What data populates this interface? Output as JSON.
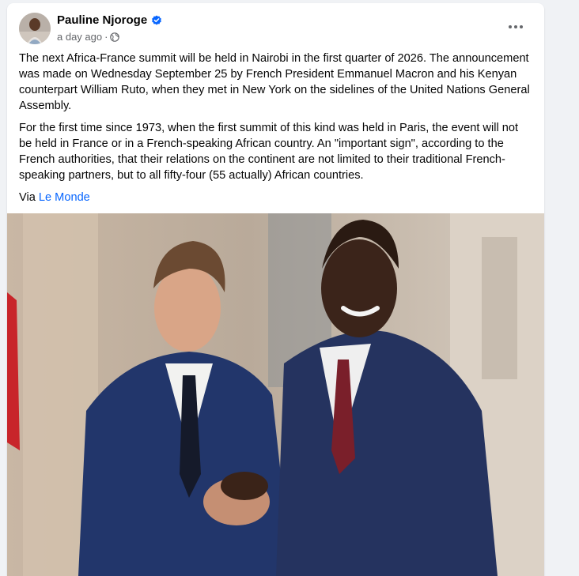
{
  "post": {
    "author": "Pauline Njoroge",
    "timestamp": "a day ago",
    "separator": "·",
    "paragraphs": [
      "The next Africa-France summit will be held in Nairobi in the first quarter of 2026. The announcement was made on Wednesday September 25 by French President Emmanuel Macron and his Kenyan counterpart William Ruto, when they met in New York on the sidelines of the United Nations General Assembly.",
      "For the first time since 1973, when the first summit of this kind was held in Paris, the event will not be held in France or in a French-speaking African country. An \"important sign\", according to the French authorities, that their relations on the continent are not limited to their traditional French-speaking partners, but to all fifty-four (55 actually) African countries."
    ],
    "via_prefix": "Via ",
    "via_link": "Le Monde"
  },
  "icons": {
    "verified": "verified-badge-icon",
    "privacy": "globe-icon",
    "more": "more-horizontal-icon"
  },
  "colors": {
    "background": "#f0f2f5",
    "card": "#ffffff",
    "link": "#0866ff",
    "verified": "#0866ff",
    "meta": "#65676b"
  }
}
